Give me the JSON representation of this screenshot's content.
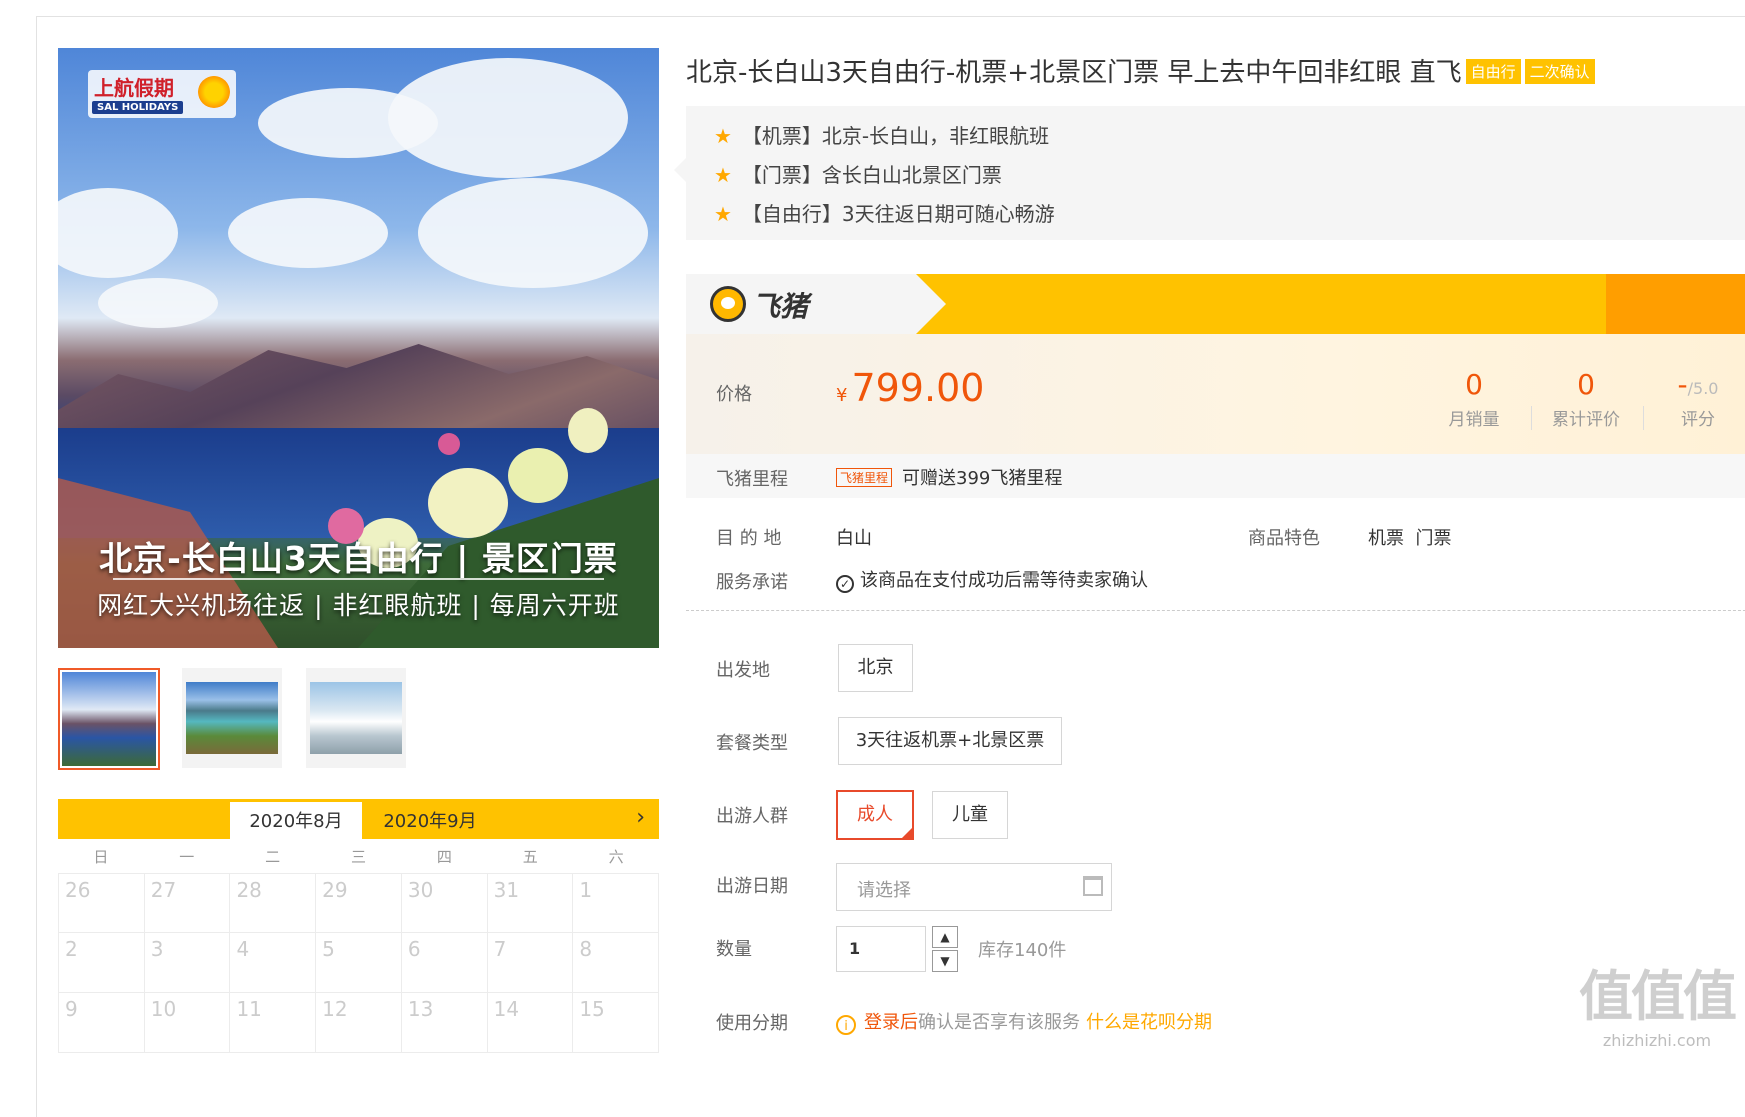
{
  "image": {
    "logo_cn": "上航假期",
    "logo_en": "SAL HOLIDAYS",
    "overlay_title": "北京-长白山3天自由行 | 景区门票",
    "overlay_sub": "网红大兴机场往返 | 非红眼航班 | 每周六开班"
  },
  "calendar": {
    "months": [
      "2020年8月",
      "2020年9月"
    ],
    "weekdays": [
      "日",
      "一",
      "二",
      "三",
      "四",
      "五",
      "六"
    ],
    "weeks": [
      [
        "26",
        "27",
        "28",
        "29",
        "30",
        "31",
        "1"
      ],
      [
        "2",
        "3",
        "4",
        "5",
        "6",
        "7",
        "8"
      ],
      [
        "9",
        "10",
        "11",
        "12",
        "13",
        "14",
        "15"
      ]
    ]
  },
  "product": {
    "title": "北京-长白山3天自由行-机票+北景区门票 早上去中午回非红眼 直飞",
    "tags": [
      "自由行",
      "二次确认"
    ],
    "highlights": [
      "【机票】北京-长白山，非红眼航班",
      "【门票】含长白山北景区门票",
      "【自由行】3天往返日期可随心畅游"
    ]
  },
  "brand": {
    "name": "飞猪"
  },
  "price": {
    "label": "价格",
    "currency": "¥",
    "value": "799.00",
    "monthly_sales_value": "0",
    "monthly_sales_label": "月销量",
    "reviews_value": "0",
    "reviews_label": "累计评价",
    "rating_value": "-",
    "rating_max": "/5.0",
    "rating_label": "评分"
  },
  "miles": {
    "label": "飞猪里程",
    "tag": "飞猪里程",
    "text": "可赠送399飞猪里程"
  },
  "details": {
    "destination_label": "目 的 地",
    "destination_value": "白山",
    "features_label": "商品特色",
    "features_value": "机票  门票",
    "service_label": "服务承诺",
    "service_value": "该商品在支付成功后需等待卖家确认"
  },
  "options": {
    "departure_label": "出发地",
    "departure_value": "北京",
    "package_label": "套餐类型",
    "package_value": "3天往返机票+北景区票",
    "crowd_label": "出游人群",
    "crowd_options": [
      "成人",
      "儿童"
    ],
    "date_label": "出游日期",
    "date_placeholder": "请选择",
    "qty_label": "数量",
    "qty_value": "1",
    "stock": "库存140件",
    "install_label": "使用分期",
    "install_login": "登录后",
    "install_text": "确认是否享有该服务",
    "install_link": "什么是花呗分期"
  },
  "watermark": {
    "big": "值值值",
    "small": "zhizhizhi.com"
  },
  "colors": {
    "accent": "#ffc200",
    "price": "#f0560a",
    "selected": "#e84a2b"
  }
}
